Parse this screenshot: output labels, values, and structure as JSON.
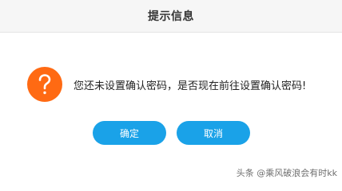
{
  "dialog": {
    "title": "提示信息",
    "message": "您还未设置确认密码，是否现在前往设置确认密码!",
    "icon": "question-icon",
    "icon_color": "#ff6a13",
    "buttons": {
      "confirm_label": "确定",
      "cancel_label": "取消"
    },
    "button_color": "#1aa2e8"
  },
  "watermark": {
    "text": "头条 @乘风破浪会有时kk"
  }
}
